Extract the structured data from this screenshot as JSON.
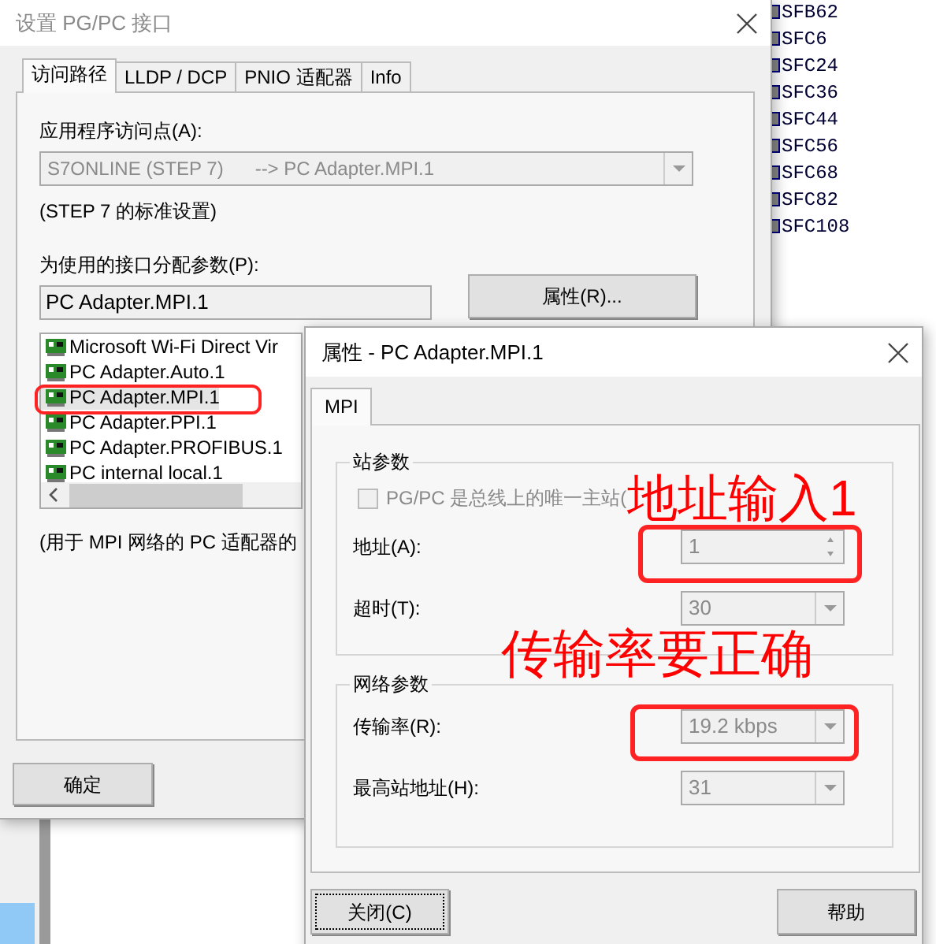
{
  "background_list": {
    "items": [
      "SFB62",
      "SFC6",
      "SFC24",
      "SFC36",
      "SFC44",
      "SFC56",
      "SFC68",
      "SFC82",
      "SFC108"
    ]
  },
  "main_dialog": {
    "title": "设置 PG/PC 接口",
    "tabs": [
      {
        "label": "访问路径",
        "selected": true
      },
      {
        "label": "LLDP / DCP",
        "selected": false
      },
      {
        "label": "PNIO 适配器",
        "selected": false
      },
      {
        "label": "Info",
        "selected": false
      }
    ],
    "access_point_label": "应用程序访问点(A):",
    "access_point_value": "S7ONLINE (STEP 7)      --> PC Adapter.MPI.1",
    "access_point_note": "(STEP 7 的标准设置)",
    "interface_label": "为使用的接口分配参数(P):",
    "interface_value": "PC Adapter.MPI.1",
    "properties_button": "属性(R)...",
    "interfaces": [
      {
        "label": "Microsoft Wi-Fi Direct Vir",
        "selected": false
      },
      {
        "label": "PC Adapter.Auto.1",
        "selected": false
      },
      {
        "label": "PC Adapter.MPI.1",
        "selected": true
      },
      {
        "label": "PC Adapter.PPI.1",
        "selected": false
      },
      {
        "label": "PC Adapter.PROFIBUS.1",
        "selected": false
      },
      {
        "label": "PC internal local.1",
        "selected": false
      }
    ],
    "description": "(用于 MPI 网络的 PC 适配器的",
    "ok_button": "确定"
  },
  "properties_dialog": {
    "title": "属性 - PC Adapter.MPI.1",
    "tabs": [
      {
        "label": "MPI",
        "selected": true
      }
    ],
    "groups": [
      {
        "title": "站参数",
        "checkbox": {
          "label": "PG/PC 是总线上的唯一主站(",
          "checked": false
        },
        "fields": [
          {
            "label": "地址(A):",
            "value": "1",
            "kind": "spinner"
          },
          {
            "label": "超时(T):",
            "value": "30",
            "kind": "combo"
          }
        ]
      },
      {
        "title": "网络参数",
        "fields": [
          {
            "label": "传输率(R):",
            "value": "19.2 kbps",
            "kind": "combo"
          },
          {
            "label": "最高站地址(H):",
            "value": "31",
            "kind": "combo"
          }
        ]
      }
    ],
    "buttons": [
      {
        "label": "关闭(C)",
        "focused": true
      },
      {
        "label": "帮助",
        "focused": false
      }
    ]
  },
  "annotations": [
    {
      "text": "地址输入1"
    },
    {
      "text": "传输率要正确"
    }
  ]
}
